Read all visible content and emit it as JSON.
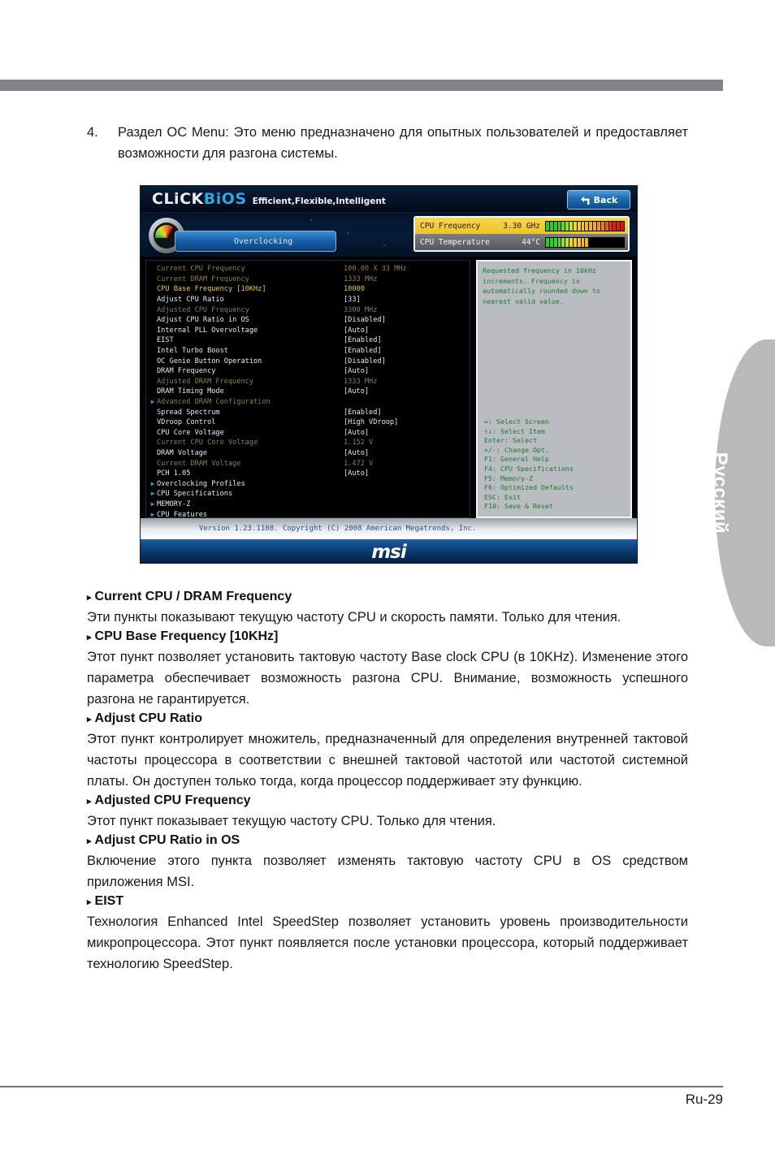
{
  "intro": {
    "number": "4.",
    "text": "Раздел OC Menu: Это меню предназначено для опытных пользователей и предоставляет возможности для разгона системы."
  },
  "bios": {
    "logo": {
      "part1": "CLiCK",
      "part2": "BiOS",
      "tagline": "Efficient,Flexible,Intelligent"
    },
    "back_button": "Back",
    "back_icon": "back-arrow-icon",
    "tab": {
      "label": "Overclocking",
      "icon": "speedometer-icon"
    },
    "meters": [
      {
        "name": "CPU Frequency",
        "value": "3.30 GHz",
        "fill_segments": 17,
        "total_segments": 20,
        "style": "freq"
      },
      {
        "name": "CPU Temperature",
        "value": "44°C",
        "fill_segments": 11,
        "total_segments": 20,
        "style": "temp"
      }
    ],
    "settings": [
      {
        "name": "Current CPU Frequency",
        "value": "100.00 X 33 MHz",
        "color": "dim",
        "arrow": false
      },
      {
        "name": "Current DRAM Frequency",
        "value": "1333 MHz",
        "color": "dim",
        "arrow": false
      },
      {
        "name": "CPU Base Frequency [10KHz]",
        "value": "10000",
        "color": "yellow",
        "arrow": false
      },
      {
        "name": "Adjust CPU Ratio",
        "value": "[33]",
        "color": "white",
        "arrow": false
      },
      {
        "name": "Adjusted CPU Frequency",
        "value": "3300 MHz",
        "color": "dim",
        "arrow": false
      },
      {
        "name": "Adjust CPU Ratio in OS",
        "value": "[Disabled]",
        "color": "white",
        "arrow": false
      },
      {
        "name": "Internal PLL Overvoltage",
        "value": "[Auto]",
        "color": "white",
        "arrow": false
      },
      {
        "name": "EIST",
        "value": "[Enabled]",
        "color": "white",
        "arrow": false
      },
      {
        "name": "Intel Turbo Boost",
        "value": "[Enabled]",
        "color": "white",
        "arrow": false
      },
      {
        "name": "OC Genie Button Operation",
        "value": "[Disabled]",
        "color": "white",
        "arrow": false
      },
      {
        "name": "DRAM Frequency",
        "value": "[Auto]",
        "color": "white",
        "arrow": false
      },
      {
        "name": "Adjusted DRAM Frequency",
        "value": "1333 MHz",
        "color": "dim",
        "arrow": false
      },
      {
        "name": "DRAM Timing Mode",
        "value": "[Auto]",
        "color": "white",
        "arrow": false
      },
      {
        "name": "Advanced DRAM Configuration",
        "value": "",
        "color": "dim",
        "arrow": true
      },
      {
        "name": "Spread Spectrum",
        "value": "[Enabled]",
        "color": "white",
        "arrow": false
      },
      {
        "name": "VDroop Control",
        "value": "[High VDroop]",
        "color": "white",
        "arrow": false
      },
      {
        "name": "CPU Core Voltage",
        "value": "[Auto]",
        "color": "white",
        "arrow": false
      },
      {
        "name": "Current CPU Core Voltage",
        "value": "1.152 V",
        "color": "dim",
        "arrow": false
      },
      {
        "name": "DRAM Voltage",
        "value": "[Auto]",
        "color": "white",
        "arrow": false
      },
      {
        "name": "Current DRAM Voltage",
        "value": "1.472 V",
        "color": "dim",
        "arrow": false
      },
      {
        "name": "PCH 1.05",
        "value": "[Auto]",
        "color": "white",
        "arrow": false
      },
      {
        "name": "Overclocking Profiles",
        "value": "",
        "color": "white",
        "arrow": true
      },
      {
        "name": "CPU Specifications",
        "value": "",
        "color": "white",
        "arrow": true
      },
      {
        "name": "MEMORY-Z",
        "value": "",
        "color": "white",
        "arrow": true
      },
      {
        "name": "CPU Features",
        "value": "",
        "color": "white",
        "arrow": true
      }
    ],
    "help": {
      "description": "Requested frequency in 10kHz increments. Frequency is automatically rounded down to nearest valid value.",
      "keys": [
        "↔: Select Screen",
        "↑↓: Select Item",
        "Enter: Select",
        "+/-: Change Opt.",
        "F1: General Help",
        "F4: CPU Specifications",
        "F5: Memory-Z",
        "F6: Optimized Defaults",
        "ESC: Exit",
        "F10: Save & Reset"
      ]
    },
    "version": "Version 1.23.1108. Copyright (C) 2008 American Megatrends, Inc.",
    "vendor_logo": "msi"
  },
  "article": [
    {
      "heading": "Current CPU / DRAM Frequency",
      "body": "Эти пункты показывают текущую частоту CPU и скорость памяти. Только для чтения."
    },
    {
      "heading": "CPU Base Frequency [10KHz]",
      "body": "Этот пункт позволяет установить тактовую частоту Base clock CPU (в 10KHz). Изменение этого параметра обеспечивает возможность разгона CPU. Внимание, возможность успешного разгона не гарантируется."
    },
    {
      "heading": "Adjust CPU Ratio",
      "body": "Этот пункт контролирует множитель, предназначенный для определения внутренней тактовой частоты процессора в соответствии с внешней тактовой частотой или частотой системной платы. Он доступен только тогда, когда процессор поддерживает эту функцию."
    },
    {
      "heading": "Adjusted CPU Frequency",
      "body": "Этот пункт показывает текущую частоту CPU. Только для чтения."
    },
    {
      "heading": "Adjust CPU Ratio in OS",
      "body": "Включение этого пункта позволяет изменять тактовую частоту CPU в OS средством приложения MSI."
    },
    {
      "heading": "EIST",
      "body": "Технология Enhanced Intel SpeedStep позволяет установить уровень производительности микропроцессора. Этот пункт появляется после установки процессора, который поддерживает технологию SpeedStep."
    }
  ],
  "side_tab": {
    "label": "Русский"
  },
  "footer": {
    "page": "Ru-29"
  },
  "colors": {
    "accent_blue": "#2fa8e8",
    "meter_yellow": "#efc425",
    "help_green": "#1d7a2c",
    "selected_yellow": "#e9c93c"
  }
}
